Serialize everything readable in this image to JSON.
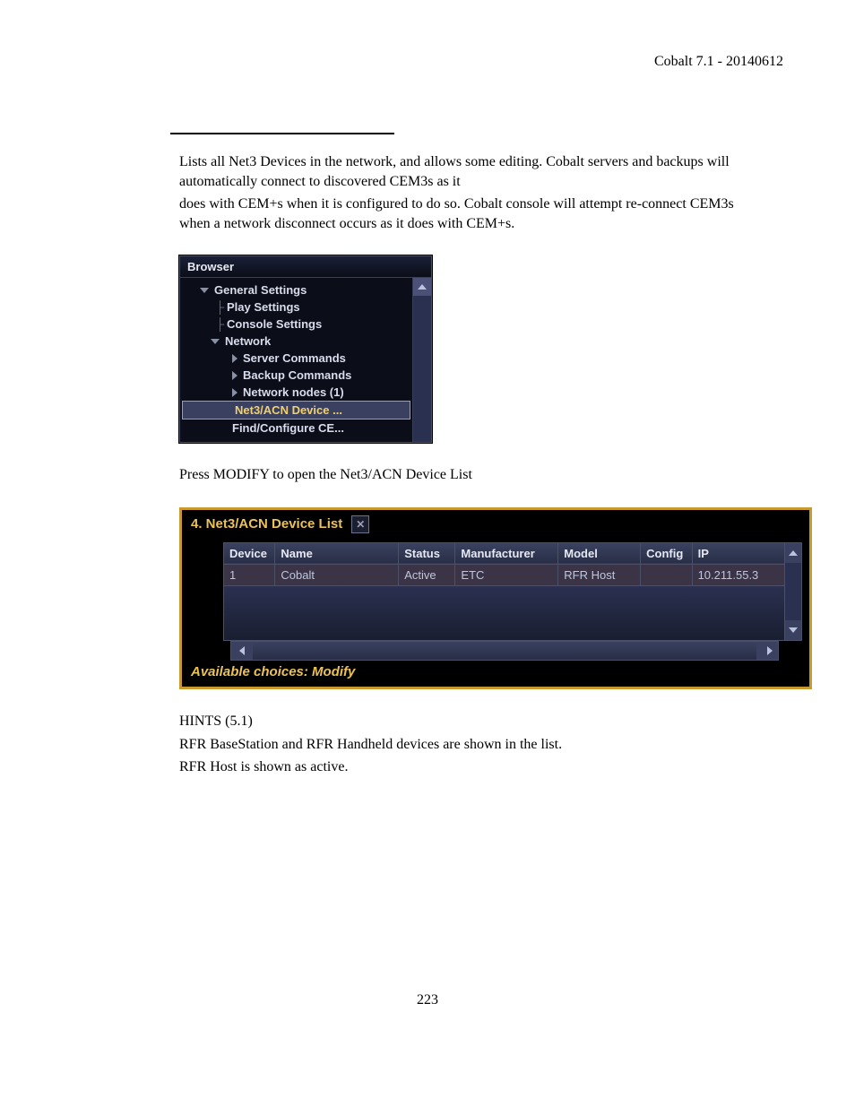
{
  "header": {
    "version": "Cobalt 7.1 - 20140612"
  },
  "intro": {
    "p1": "Lists all Net3 Devices in the network, and allows some editing. Cobalt servers and backups will automatically connect to discovered CEM3s as it",
    "p2": "does with CEM+s when it is configured to do so. Cobalt console will attempt re-connect CEM3s when a network disconnect occurs as it does with CEM+s."
  },
  "browser": {
    "title": "Browser",
    "items": {
      "general": "General Settings",
      "play": "Play Settings",
      "console": "Console Settings",
      "network": "Network",
      "server_cmds": "Server Commands",
      "backup_cmds": "Backup Commands",
      "network_nodes": "Network nodes (1)",
      "net3acn": "Net3/ACN Device ...",
      "findconf": "Find/Configure CE..."
    }
  },
  "afterbrowser": {
    "line": "Press MODIFY to open the Net3/ACN Device List"
  },
  "devicepanel": {
    "title": "4. Net3/ACN Device List",
    "columns": {
      "device": "Device",
      "name": "Name",
      "status": "Status",
      "manufacturer": "Manufacturer",
      "model": "Model",
      "config": "Config",
      "ip": "IP"
    },
    "row": {
      "device": "1",
      "name": "Cobalt",
      "status": "Active",
      "manufacturer": "ETC",
      "model": "RFR Host",
      "config": "",
      "ip": "10.211.55.3"
    },
    "footer": "Available choices: Modify"
  },
  "hints": {
    "h1": "HINTS (5.1)",
    "h2": "RFR BaseStation and RFR Handheld devices are shown in the list.",
    "h3": "RFR Host is shown as active."
  },
  "page_number": "223"
}
